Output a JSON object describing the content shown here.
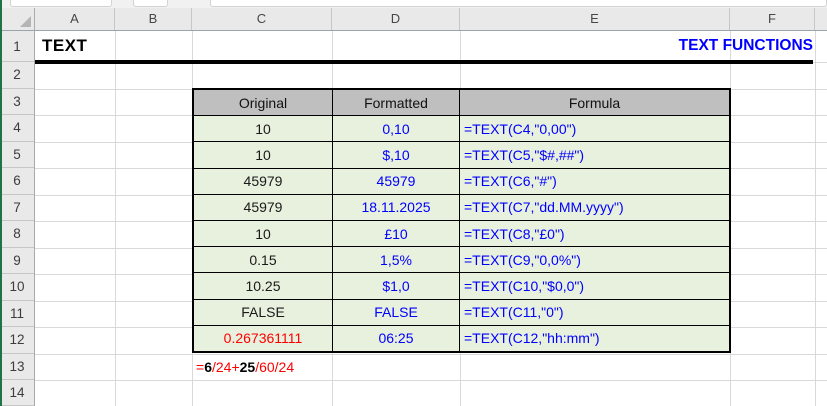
{
  "colors": {
    "excel_accent_green": "#217346",
    "formula_blue": "#0000FF",
    "alert_red": "#FF0000",
    "table_header_bg": "#BFBFBF",
    "table_cell_bg": "#E8F0DE",
    "grid_line": "#D9D9D9",
    "header_strip_bg": "#E9E9E9"
  },
  "icons": {
    "select_all": "select-all-corner-triangle"
  },
  "grid": {
    "column_headers": [
      "A",
      "B",
      "C",
      "D",
      "E",
      "F"
    ],
    "row_headers": [
      "1",
      "2",
      "3",
      "4",
      "5",
      "6",
      "7",
      "8",
      "9",
      "10",
      "11",
      "12",
      "13",
      "14"
    ]
  },
  "cells": {
    "a1": "TEXT",
    "e1_title": "TEXT FUNCTIONS",
    "c13_segments": [
      {
        "text": "=",
        "color": "red"
      },
      {
        "text": "6",
        "color": "black-bold"
      },
      {
        "text": "/24+",
        "color": "red"
      },
      {
        "text": "25",
        "color": "black-bold"
      },
      {
        "text": "/60/24",
        "color": "red"
      }
    ]
  },
  "table": {
    "headers": {
      "original": "Original",
      "formatted": "Formatted",
      "formula": "Formula"
    },
    "rows": [
      {
        "original": "10",
        "formatted": "0,10",
        "formula": "=TEXT(C4,\"0,00\")"
      },
      {
        "original": "10",
        "formatted": "$,10",
        "formula": "=TEXT(C5,\"$#,##\")"
      },
      {
        "original": "45979",
        "formatted": "45979",
        "formula": "=TEXT(C6,\"#\")"
      },
      {
        "original": "45979",
        "formatted": "18.11.2025",
        "formula": "=TEXT(C7,\"dd.MM.yyyy\")"
      },
      {
        "original": "10",
        "formatted": "£10",
        "formula": "=TEXT(C8,\"£0\")"
      },
      {
        "original": "0.15",
        "formatted": "1,5%",
        "formula": "=TEXT(C9,\"0,0%\")"
      },
      {
        "original": "10.25",
        "formatted": "$1,0",
        "formula": "=TEXT(C10,\"$0,0\")"
      },
      {
        "original": "FALSE",
        "formatted": "FALSE",
        "formula": "=TEXT(C11,\"0\")"
      },
      {
        "original": "0.267361111",
        "formatted": "06:25",
        "formula": "=TEXT(C12,\"hh:mm\")",
        "original_color": "#FF0000"
      }
    ]
  }
}
